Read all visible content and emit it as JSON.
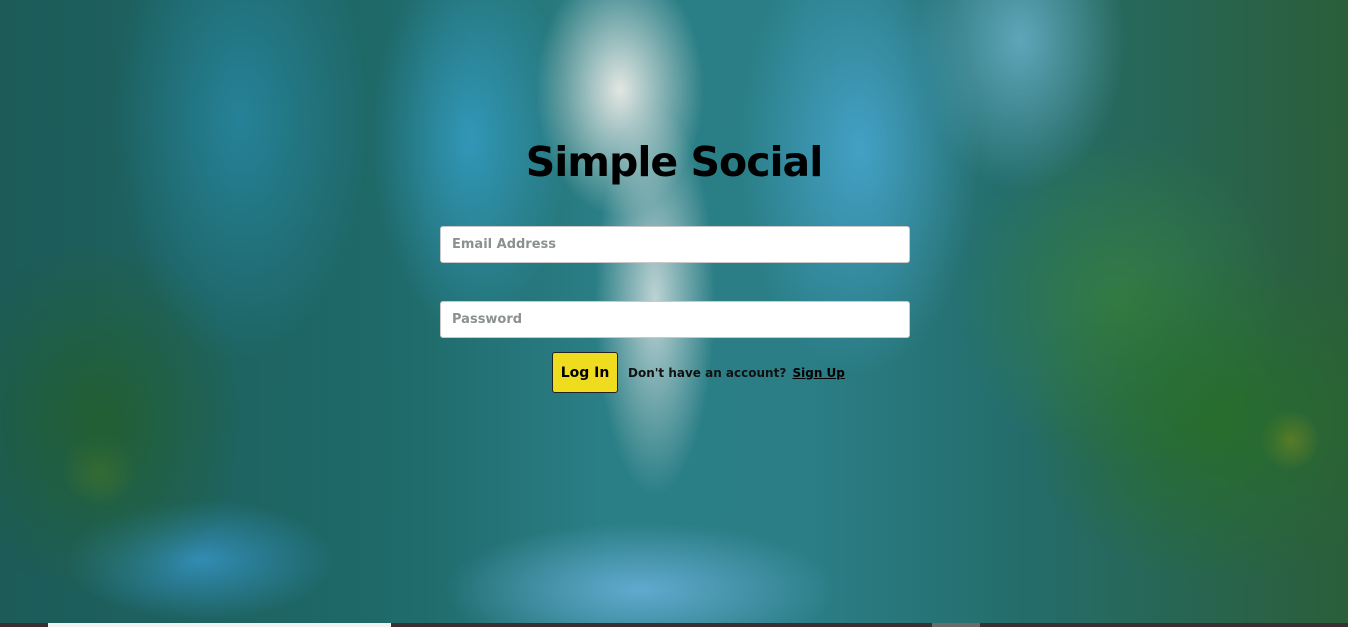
{
  "app": {
    "title": "Simple Social"
  },
  "login_form": {
    "email_placeholder": "Email Address",
    "password_placeholder": "Password",
    "login_label": "Log In",
    "signup_prompt": "Don't have an account?",
    "signup_link": "Sign Up"
  },
  "colors": {
    "button_background": "#f0dc1e",
    "text": "#000000"
  }
}
